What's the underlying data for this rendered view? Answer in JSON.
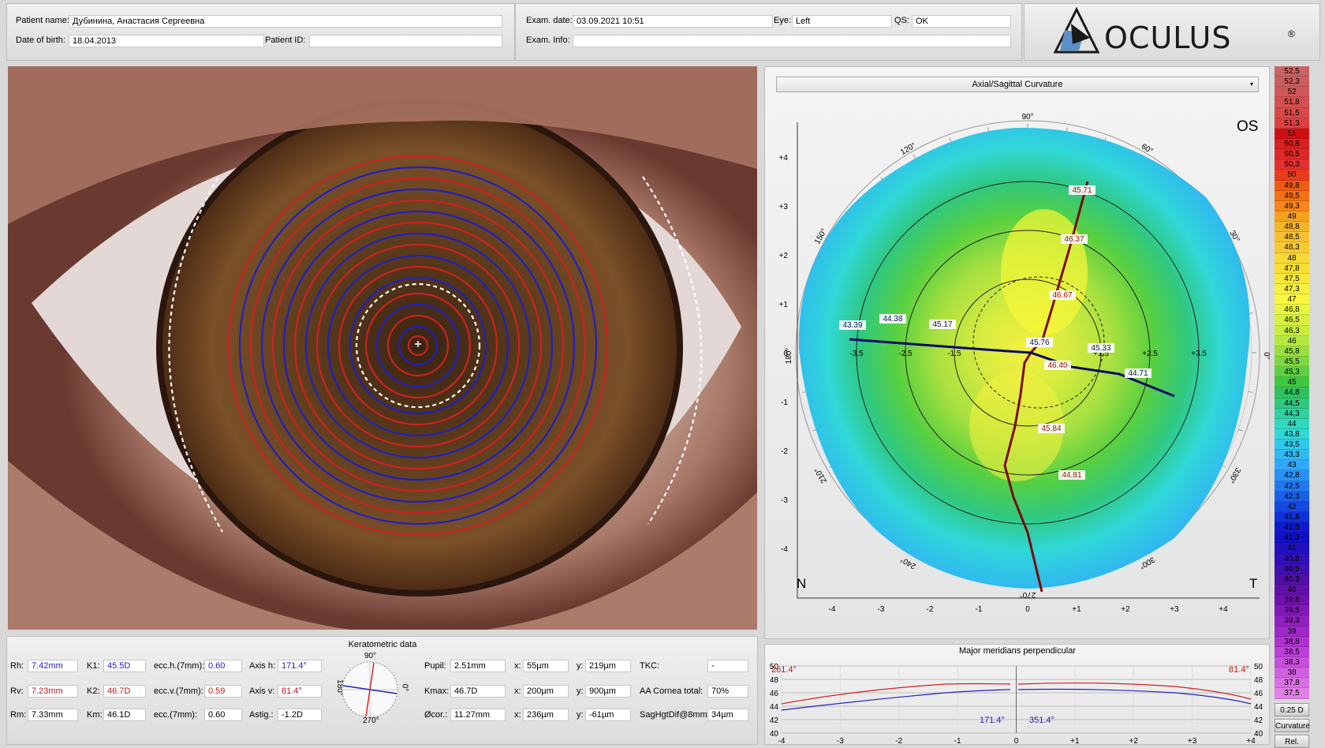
{
  "header": {
    "patient_name_label": "Patient name:",
    "patient_name": "Дубинина, Анастасия Сергеевна",
    "dob_label": "Date of birth:",
    "dob": "18.04.2013",
    "patient_id_label": "Patient ID:",
    "patient_id": "",
    "exam_date_label": "Exam. date:",
    "exam_date": "03.09.2021 10:51",
    "eye_label": "Eye:",
    "eye": "Left",
    "qs_label": "QS:",
    "qs": "OK",
    "exam_info_label": "Exam. Info:",
    "exam_info": "",
    "logo_text": "OCULUS",
    "logo_reg": "®"
  },
  "map": {
    "dropdown": "Axial/Sagittal Curvature",
    "eye_tag": "OS",
    "nasal": "N",
    "temporal": "T",
    "angle_labels": [
      "90°",
      "60°",
      "30°",
      "0°",
      "330°",
      "300°",
      "270°",
      "240°",
      "210°",
      "180°",
      "150°",
      "120°"
    ],
    "y_ticks": [
      "+4",
      "+3",
      "+2",
      "+1",
      "0",
      "-1",
      "-2",
      "-3",
      "-4"
    ],
    "x_ticks": [
      "-4",
      "-3",
      "-2",
      "-1",
      "0",
      "+1",
      "+2",
      "+3",
      "+4"
    ],
    "ring_labels": [
      "-3.5",
      "-2.5",
      "-1.5",
      "+1.5",
      "+2.5",
      "+3.5"
    ],
    "steep_meridian_values": [
      "45.71",
      "46.37",
      "46.67",
      "46.40",
      "45.84",
      "44.81"
    ],
    "flat_meridian_values": [
      "43.39",
      "44.38",
      "45.17",
      "45.76",
      "45.33",
      "44.71"
    ]
  },
  "scale": {
    "values": [
      "52,5",
      "52,3",
      "52",
      "51,8",
      "51,5",
      "51,3",
      "51",
      "50,8",
      "50,5",
      "50,3",
      "50",
      "49,8",
      "49,5",
      "49,3",
      "49",
      "48,8",
      "48,5",
      "48,3",
      "48",
      "47,8",
      "47,5",
      "47,3",
      "47",
      "46,8",
      "46,5",
      "46,3",
      "46",
      "45,8",
      "45,5",
      "45,3",
      "45",
      "44,8",
      "44,5",
      "44,3",
      "44",
      "43,8",
      "43,5",
      "43,3",
      "43",
      "42,8",
      "42,5",
      "42,3",
      "42",
      "41,8",
      "41,5",
      "41,3",
      "41",
      "40,8",
      "40,5",
      "40,3",
      "40",
      "39,8",
      "39,5",
      "39,3",
      "39",
      "38,8",
      "38,5",
      "38,3",
      "38",
      "37,8",
      "37,5"
    ],
    "colors": [
      "#c86464",
      "#cc5e5e",
      "#d05858",
      "#d45050",
      "#d84848",
      "#dc4040",
      "#d01010",
      "#d82020",
      "#e02828",
      "#e43030",
      "#e83c1c",
      "#f05a10",
      "#f47010",
      "#f88618",
      "#f4a020",
      "#f4b428",
      "#f8c030",
      "#f8cc30",
      "#f8d838",
      "#f8e030",
      "#f8e838",
      "#f8f040",
      "#f8f840",
      "#e8f840",
      "#d8f040",
      "#c8ec40",
      "#b4e840",
      "#98e040",
      "#7cd840",
      "#5cd040",
      "#40c840",
      "#30c060",
      "#30c880",
      "#30d0a0",
      "#30d8c0",
      "#30d8d8",
      "#30c8e8",
      "#30b8f0",
      "#30a8f8",
      "#2890f8",
      "#2078f0",
      "#1860e8",
      "#1448e0",
      "#1030d8",
      "#1018d0",
      "#1010c8",
      "#2010c0",
      "#3010b8",
      "#4010b0",
      "#5010a8",
      "#6010a8",
      "#7010b0",
      "#8018b8",
      "#9020c0",
      "#a028c8",
      "#b030d0",
      "#bc40d8",
      "#c850dc",
      "#d060e0",
      "#d870e4",
      "#e080e8"
    ],
    "step_label": "0.25 D",
    "mode_label": "Curvature",
    "rel_label": "Rel."
  },
  "kerato": {
    "title": "Keratometric data",
    "rh_label": "Rh:",
    "rh": "7.42mm",
    "rv_label": "Rv:",
    "rv": "7.23mm",
    "rm_label": "Rm:",
    "rm": "7.33mm",
    "k1_label": "K1:",
    "k1": "45.5D",
    "k2_label": "K2:",
    "k2": "46.7D",
    "km_label": "Km:",
    "km": "46.1D",
    "ecch_label": "ecc.h.(7mm):",
    "ecch": "0.60",
    "eccv_label": "ecc.v.(7mm):",
    "eccv": "0.59",
    "ecc_label": "ecc.(7mm):",
    "ecc": "0.60",
    "axish_label": "Axis h:",
    "axish": "171.4°",
    "axisv_label": "Axis v:",
    "axisv": "81.4°",
    "astig_label": "Astig.:",
    "astig": "-1.2D",
    "dial_top": "90°",
    "dial_bottom": "270°",
    "dial_left": "180°",
    "dial_right": "0°",
    "pupil_label": "Pupil:",
    "pupil": "2.51mm",
    "kmax_label": "Kmax:",
    "kmax": "46.7D",
    "ocor_label": "Øcor.:",
    "ocor": "11.27mm",
    "x1_label": "x:",
    "x1": "55µm",
    "x2_label": "x:",
    "x2": "200µm",
    "x3_label": "x:",
    "x3": "236µm",
    "y1_label": "y:",
    "y1": "219µm",
    "y2_label": "y:",
    "y2": "900µm",
    "y3_label": "y:",
    "y3": "-61µm",
    "tkc_label": "TKC:",
    "tkc": "-",
    "aa_label": "AA Cornea total:",
    "aa": "70%",
    "sag_label": "SagHgtDif@8mm:",
    "sag": "34µm"
  },
  "meridians": {
    "title": "Major meridians perpendicular",
    "y_ticks": [
      "50",
      "48",
      "46",
      "44",
      "42",
      "40"
    ],
    "x_ticks": [
      "-4",
      "-3",
      "-2",
      "-1",
      "0",
      "+1",
      "+2",
      "+3",
      "+4"
    ],
    "left_red": "261.4°",
    "right_red": "81.4°",
    "left_blue": "171.4°",
    "right_blue": "351.4°",
    "colors": {
      "red": "#d02020",
      "blue": "#2020c0"
    }
  }
}
